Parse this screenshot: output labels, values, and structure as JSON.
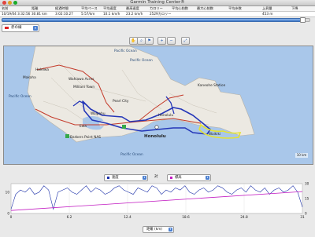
{
  "window": {
    "title": "Garmin Training Center®"
  },
  "table": {
    "columns": [
      "名前",
      "距離",
      "経過時間",
      "平均ペース",
      "平均速度",
      "最高速度",
      "カロリー",
      "平均心拍数",
      "最大心拍数",
      "平均歩数",
      "上昇量",
      "下降"
    ],
    "row": [
      "10/19/04 3:32:56",
      "30.81 km",
      "3:02:10.27",
      "5:57/km",
      "10.1 km/h",
      "23.2 km/h",
      "2529カロリー",
      "",
      "",
      "",
      "453 m",
      ""
    ]
  },
  "progress": {
    "value": 0.98
  },
  "track_select": {
    "label": "赤の線"
  },
  "toolbar": {
    "buttons": [
      {
        "name": "hand-tool-icon",
        "glyph": "✋"
      },
      {
        "name": "zoom-selection-icon",
        "glyph": "⌕"
      },
      {
        "name": "flag-icon",
        "glyph": "⚑"
      },
      {
        "name": "zoom-in-icon",
        "glyph": "+"
      },
      {
        "name": "zoom-out-icon",
        "glyph": "−"
      },
      {
        "name": "zoom-fit-icon",
        "glyph": "⤢"
      }
    ]
  },
  "map": {
    "labels": {
      "haleiwa": "Haleiwa",
      "wahiawa": "Wahiawa Acres",
      "mililani": "Mililani Town",
      "makaha": "Makaha",
      "pacific_nw": "Pacific Ocean",
      "pacific_ne": "Pacific Ocean",
      "pacific_w": "Pacific Ocean",
      "pacific_s": "Pacific Ocean",
      "kaneohe": "Kaneohe Station",
      "pearl_city": "Pearl City",
      "waipahu": "Waipahu",
      "ewa": "Ewa",
      "honolulu_small": "Honolulu",
      "honolulu": "Honolulu",
      "waikiki": "Waikiki",
      "barbers": "Barbers Point NAS"
    },
    "scale": "10 km"
  },
  "chart_controls": {
    "left_label": "速度",
    "vs_label": "対",
    "right_label": "標高",
    "xaxis_select": "距離 (km)"
  },
  "chart_data": {
    "type": "line",
    "xlabel": "距離 (km)",
    "xlim": [
      0,
      31
    ],
    "x_ticks": [
      "0",
      "6.2",
      "12.4",
      "18.6",
      "24.8",
      "31"
    ],
    "y_left_ticks": [
      "10",
      "0"
    ],
    "y_right_ticks": [
      "30",
      "15",
      "0"
    ],
    "series": [
      {
        "name": "速度",
        "color": "#1b2fa8",
        "x": [
          0,
          0.5,
          1,
          1.5,
          2,
          2.5,
          3,
          3.5,
          4,
          4.5,
          5,
          5.5,
          6,
          6.5,
          7,
          7.5,
          8,
          8.5,
          9,
          9.5,
          10,
          10.5,
          11,
          11.5,
          12,
          12.5,
          13,
          13.5,
          14,
          14.5,
          15,
          15.5,
          16,
          16.5,
          17,
          17.5,
          18,
          18.5,
          19,
          19.5,
          20,
          20.5,
          21,
          21.5,
          22,
          22.5,
          23,
          23.5,
          24,
          24.5,
          25,
          25.5,
          26,
          26.5,
          27,
          27.5,
          28,
          28.5,
          29,
          29.5,
          30,
          30.5,
          31
        ],
        "y": [
          2,
          9,
          11,
          10,
          12,
          9,
          10,
          13,
          11,
          2,
          10,
          11,
          12,
          10,
          9,
          11,
          13,
          10,
          12,
          11,
          9,
          10,
          12,
          13,
          11,
          10,
          9,
          12,
          11,
          10,
          13,
          12,
          9,
          11,
          10,
          12,
          11,
          13,
          10,
          9,
          11,
          12,
          10,
          11,
          13,
          12,
          10,
          9,
          11,
          12,
          10,
          13,
          11,
          10,
          12,
          9,
          11,
          12,
          10,
          11,
          13,
          10,
          3
        ]
      },
      {
        "name": "標高",
        "color": "#c21cc2",
        "x": [
          0,
          31
        ],
        "y": [
          3,
          22
        ]
      }
    ]
  }
}
